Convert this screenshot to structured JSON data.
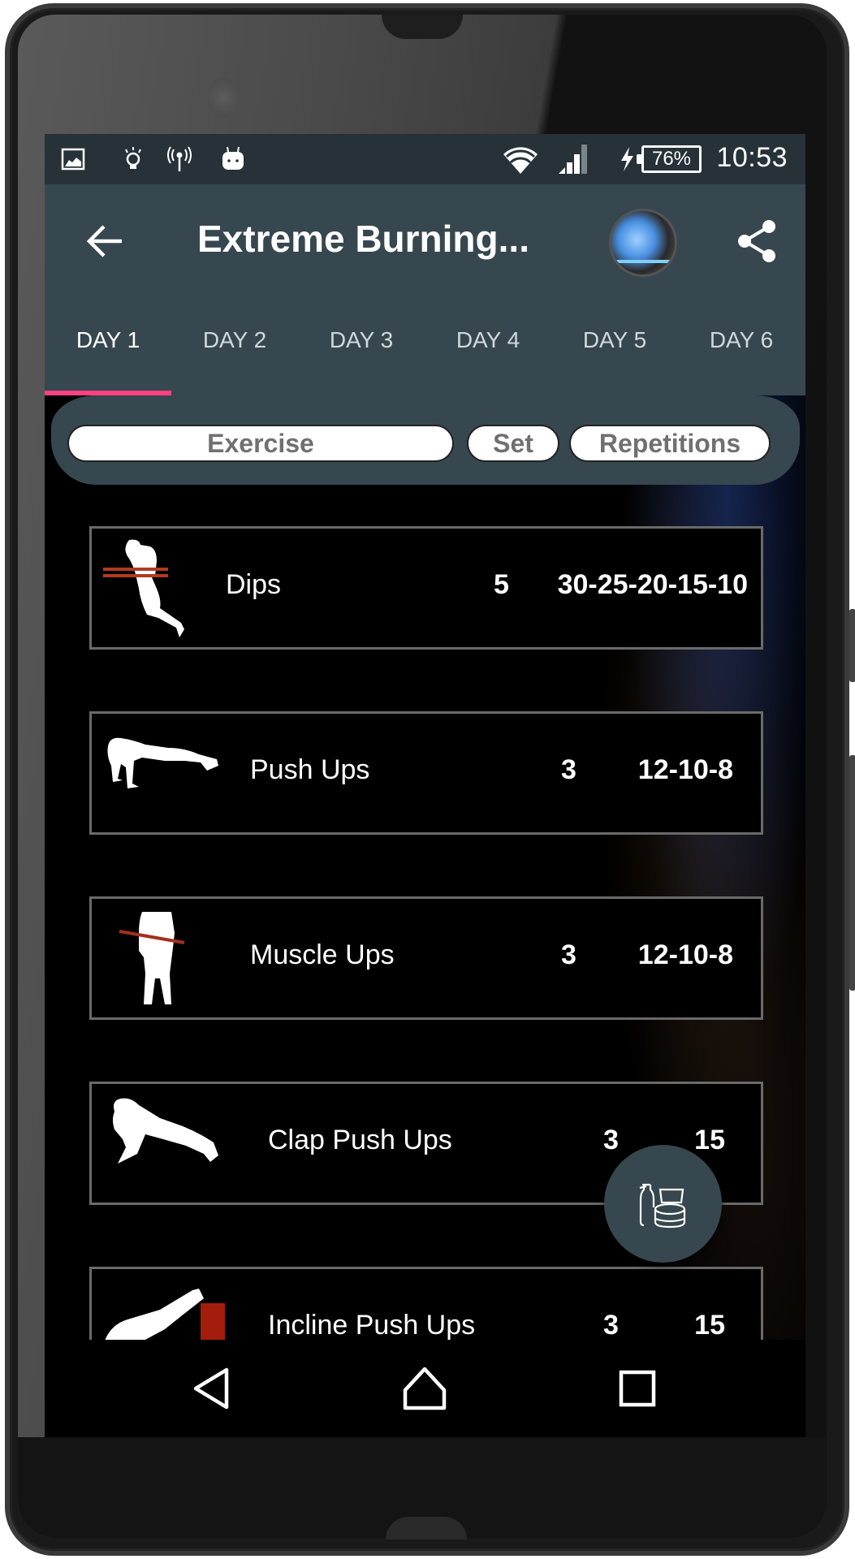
{
  "status_bar": {
    "left_icons": [
      "image-icon",
      "lightbulb-icon",
      "hotspot-icon",
      "android-icon"
    ],
    "right_icons": [
      "wifi-icon",
      "signal-icon",
      "charging-icon"
    ],
    "battery_percent": "76%",
    "time": "10:53"
  },
  "toolbar": {
    "title": "Extreme Burning...",
    "back_icon": "arrow-left-icon",
    "avatar_icon": "app-logo-avatar",
    "share_icon": "share-icon"
  },
  "tabs": [
    {
      "label": "DAY 1",
      "active": true
    },
    {
      "label": "DAY 2",
      "active": false
    },
    {
      "label": "DAY 3",
      "active": false
    },
    {
      "label": "DAY 4",
      "active": false
    },
    {
      "label": "DAY 5",
      "active": false
    },
    {
      "label": "DAY 6",
      "active": false
    }
  ],
  "table_header": {
    "exercise": "Exercise",
    "set": "Set",
    "repetitions": "Repetitions"
  },
  "exercises": [
    {
      "name": "Dips",
      "sets": "5",
      "reps": "30-25-20-15-10",
      "icon": "dips-figure-icon"
    },
    {
      "name": "Push Ups",
      "sets": "3",
      "reps": "12-10-8",
      "icon": "push-ups-figure-icon"
    },
    {
      "name": "Muscle Ups",
      "sets": "3",
      "reps": "12-10-8",
      "icon": "muscle-ups-figure-icon"
    },
    {
      "name": "Clap Push Ups",
      "sets": "3",
      "reps": "15",
      "icon": "clap-push-ups-figure-icon"
    },
    {
      "name": "Incline Push Ups",
      "sets": "3",
      "reps": "15",
      "icon": "incline-push-ups-figure-icon"
    }
  ],
  "fab": {
    "icon": "nutrition-supplements-icon"
  },
  "nav_bar": {
    "back": "nav-back-icon",
    "home": "nav-home-icon",
    "recents": "nav-recents-icon"
  },
  "colors": {
    "status_bar": "#263238",
    "toolbar": "#37474f",
    "tab_indicator": "#ff4081",
    "tab_active_text": "#ffffff",
    "tab_inactive_text": "#cfd8dc",
    "row_border": "#6a6a6a",
    "header_text": "#707070"
  }
}
